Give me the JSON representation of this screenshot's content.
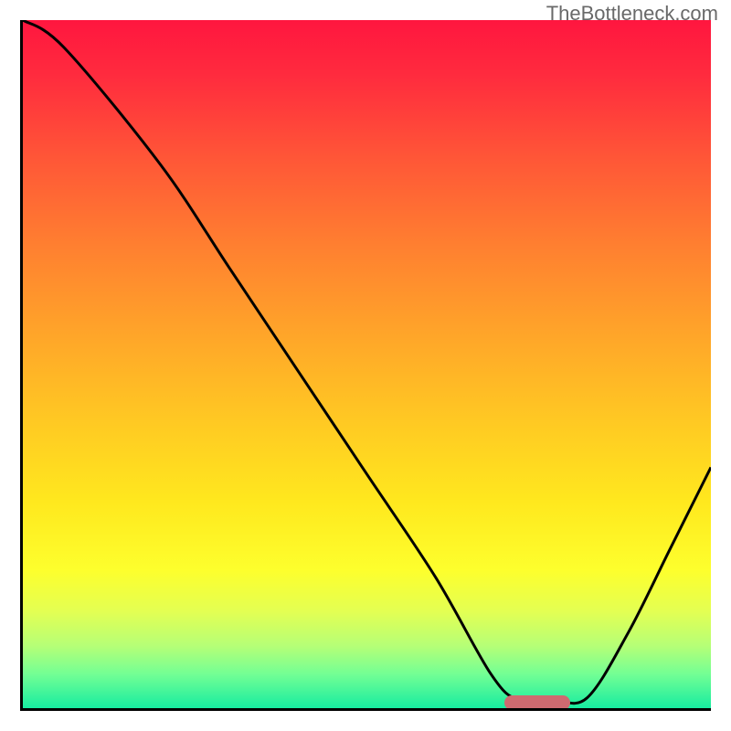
{
  "watermark": "TheBottleneck.com",
  "chart_data": {
    "type": "line",
    "title": "",
    "xlabel": "",
    "ylabel": "",
    "xlim": [
      0,
      100
    ],
    "ylim": [
      0,
      100
    ],
    "x": [
      0,
      6,
      20,
      30,
      40,
      50,
      60,
      68,
      72,
      77,
      82,
      88,
      94,
      100
    ],
    "values": [
      100,
      96,
      79,
      64,
      49,
      34,
      19,
      5,
      1.2,
      1.2,
      1.5,
      11,
      23,
      35
    ],
    "marker": {
      "x": 74.5,
      "y": 1.2
    },
    "gradient_stops": [
      {
        "pct": 0,
        "color": "#ff163f"
      },
      {
        "pct": 100,
        "color": "#17eca0"
      }
    ]
  }
}
